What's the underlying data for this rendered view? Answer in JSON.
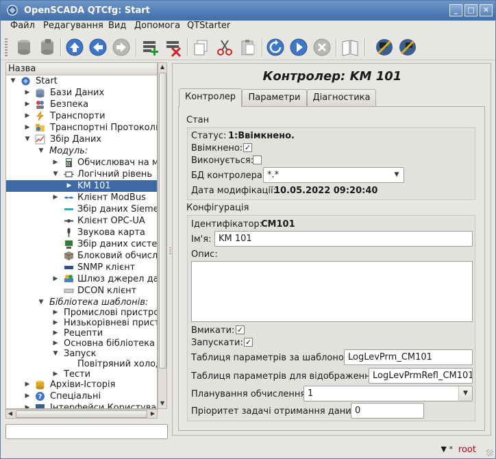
{
  "window": {
    "title": "OpenSCADA QTCfg: Start",
    "controls": [
      "_",
      "□",
      "✕"
    ]
  },
  "menu": [
    "Файл",
    "Редагування",
    "Вид",
    "Допомога",
    "QTStarter"
  ],
  "toolbar": [
    "db-load-icon",
    "db-save-icon",
    "up-icon",
    "back-icon",
    "forward-icon",
    "add-item-icon",
    "delete-item-icon",
    "copy-icon",
    "cut-icon",
    "paste-icon",
    "refresh-icon",
    "start-icon",
    "stop-icon",
    "manual-icon",
    "manual-tool-icon",
    "manual-program-icon"
  ],
  "tree": {
    "header": "Назва",
    "items": [
      {
        "label": "Start"
      },
      {
        "label": "Бази Даних"
      },
      {
        "label": "Безпека"
      },
      {
        "label": "Транспорти"
      },
      {
        "label": "Транспортні Протоколи"
      },
      {
        "label": "Збір Даних"
      },
      {
        "label": "Модуль:"
      },
      {
        "label": "Обчислювач на мо"
      },
      {
        "label": "Логічний рівень"
      },
      {
        "label": "KM 101"
      },
      {
        "label": "Клієнт ModBus"
      },
      {
        "label": "Збір даних Siemen"
      },
      {
        "label": "Клієнт OPC-UA"
      },
      {
        "label": "Звукова карта"
      },
      {
        "label": "Збір даних систем"
      },
      {
        "label": "Блоковий обчислю"
      },
      {
        "label": "SNMP клієнт"
      },
      {
        "label": "Шлюз джерел дан"
      },
      {
        "label": "DCON клієнт"
      },
      {
        "label": "Бібліотека шаблонів:"
      },
      {
        "label": "Промислові пристрої"
      },
      {
        "label": "Низькорівневі пристр"
      },
      {
        "label": "Рецепти"
      },
      {
        "label": "Основна бібліотека"
      },
      {
        "label": "Запуск"
      },
      {
        "label": "Повітряний холоди"
      },
      {
        "label": "Тести"
      },
      {
        "label": "Архіви-Історія"
      },
      {
        "label": "Спеціальні"
      },
      {
        "label": "Інтерфейси Користувача"
      }
    ]
  },
  "page": {
    "title": "Контролер: KM 101",
    "tabs": [
      "Контролер",
      "Параметри",
      "Діагностика"
    ],
    "state": {
      "section": "Стан",
      "status_label": "Статус:",
      "status_value": "1:Ввімкнено.",
      "enabled_label": "Ввімкнено:",
      "enabled_checked": true,
      "running_label": "Виконується:",
      "running_checked": false,
      "db_label": "БД контролера:",
      "db_value": "*.*",
      "modified_label": "Дата модифікації:",
      "modified_value": "10.05.2022 09:20:40"
    },
    "config": {
      "section": "Конфігурація",
      "id_label": "Ідентифікатор:",
      "id_value": "CM101",
      "name_label": "Ім'я:",
      "name_value": "KM 101",
      "descr_label": "Опис:",
      "descr_value": "",
      "enable_label": "Вмикати:",
      "enable_checked": true,
      "start_label": "Запускати:",
      "start_checked": true,
      "prm_table_label": "Таблиця параметрів за шаблоном:",
      "prm_table_value": "LogLevPrm_CM101",
      "prm_refl_label": "Таблиця параметрів для відображення:",
      "prm_refl_value": "LogLevPrmRefl_CM101",
      "schedule_label": "Планування обчислення:",
      "schedule_value": "1",
      "priority_label": "Пріоритет задачі отримання даних:",
      "priority_value": "0"
    }
  },
  "status": {
    "user": "root",
    "mark": "*"
  },
  "colors": {
    "accent": "#3d6aa6",
    "titlebar": "#4f7bb5",
    "user": "#c0000b"
  }
}
